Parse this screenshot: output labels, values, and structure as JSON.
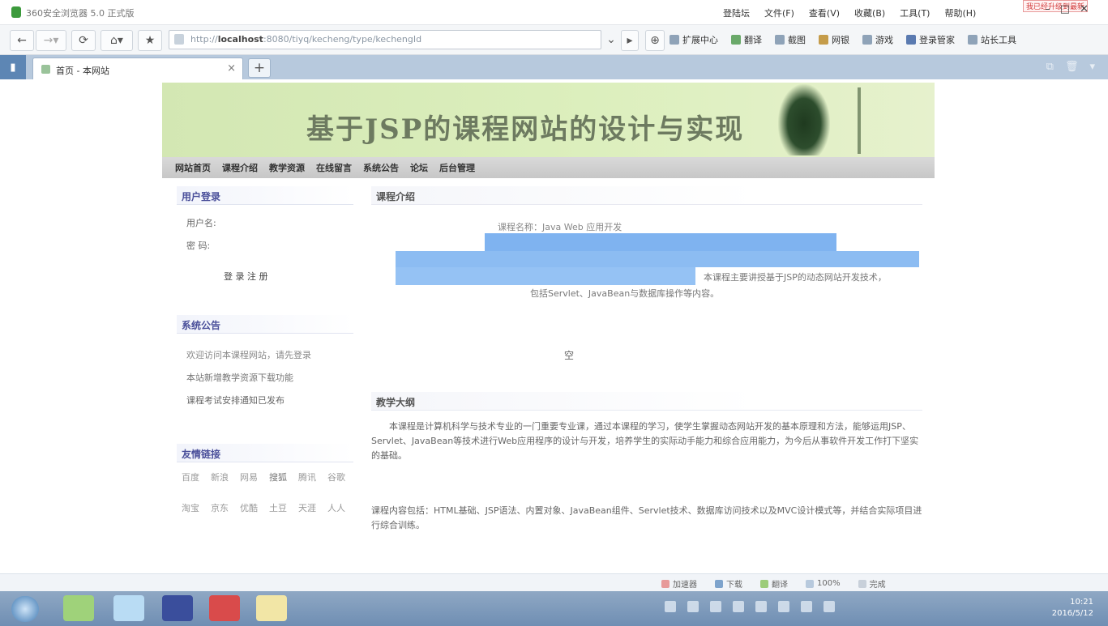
{
  "window": {
    "title": "360安全浏览器 5.0 正式版",
    "menu": [
      "登陆坛",
      "文件(F)",
      "查看(V)",
      "收藏(B)",
      "工具(T)",
      "帮助(H)"
    ],
    "badge": "我已经升级到最新"
  },
  "toolbar": {
    "url_prefix": "http://",
    "url_host": "localhost",
    "url_rest": ":8080/tiyq/kecheng/type/kechengId",
    "tools": [
      "扩展中心",
      "翻译",
      "截图",
      "网银",
      "游戏",
      "登录管家",
      "站长工具"
    ]
  },
  "tabs": [
    {
      "label": "首页 - 本网站"
    }
  ],
  "page": {
    "banner_title": "基于JSP的课程网站的设计与实现",
    "nav": [
      "网站首页",
      "课程介绍",
      "教学资源",
      "在线留言",
      "系统公告",
      "论坛",
      "后台管理"
    ],
    "left": {
      "sect1": "用户登录",
      "sect1_lines": [
        "用户名:",
        "密 码:"
      ],
      "sect1_buttons": "登 录   注 册",
      "sect2": "系统公告",
      "sect2_lines": [
        "欢迎访问本课程网站，请先登录",
        "本站新增教学资源下载功能",
        "课程考试安排通知已发布"
      ],
      "sect3": "友情链接",
      "links_row1": [
        "百度",
        "新浪",
        "网易",
        "搜狐",
        "腾讯",
        "谷歌"
      ],
      "links_row2": [
        "淘宝",
        "京东",
        "优酷",
        "土豆",
        "天涯",
        "人人"
      ]
    },
    "right": {
      "sect1": "课程介绍",
      "lead": "课程名称：Java Web 应用开发",
      "blue_text": "本课程主要讲授基于JSP的动态网站开发技术，",
      "blue_text2": "包括Servlet、JavaBean与数据库操作等内容。",
      "mark": "空",
      "sect2": "教学大纲",
      "para1": "本课程是计算机科学与技术专业的一门重要专业课，通过本课程的学习，使学生掌握动态网站开发的基本原理和方法，能够运用JSP、Servlet、JavaBean等技术进行Web应用程序的设计与开发，培养学生的实际动手能力和综合应用能力，为今后从事软件开发工作打下坚实的基础。",
      "para2": "课程内容包括：HTML基础、JSP语法、内置对象、JavaBean组件、Servlet技术、数据库访问技术以及MVC设计模式等，并结合实际项目进行综合训练。"
    }
  },
  "statusbar": [
    "加速器",
    "下载",
    "翻译",
    "100%",
    "完成"
  ],
  "clock": {
    "time": "10:21",
    "date": "2016/5/12"
  }
}
